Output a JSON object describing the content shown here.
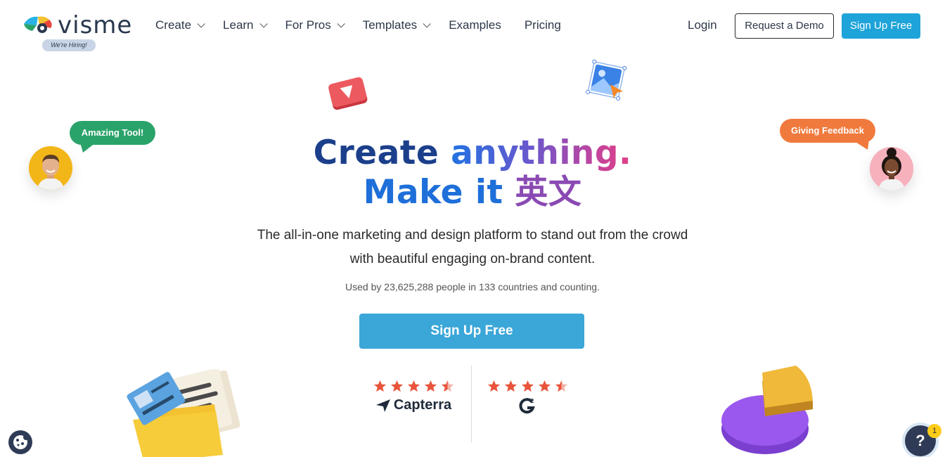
{
  "nav": {
    "logo_text": "visme",
    "hiring_badge": "We're Hiring!",
    "menu": [
      {
        "label": "Create",
        "has_dropdown": true
      },
      {
        "label": "Learn",
        "has_dropdown": true
      },
      {
        "label": "For Pros",
        "has_dropdown": true
      },
      {
        "label": "Templates",
        "has_dropdown": true
      },
      {
        "label": "Examples",
        "has_dropdown": false
      },
      {
        "label": "Pricing",
        "has_dropdown": false
      }
    ],
    "login": "Login",
    "request_demo": "Request a Demo",
    "sign_up": "Sign Up Free"
  },
  "hero": {
    "title_line1_part1": "Create",
    "title_line1_part2": "anything.",
    "title_line2_part1": "Make it",
    "title_line2_part2": "英文",
    "subtitle_line1": "The all-in-one marketing and design platform to stand out from the crowd",
    "subtitle_line2": "with beautiful engaging on-brand content.",
    "used_by": "Used by 23,625,288 people in 133 countries and counting.",
    "cta": "Sign Up Free"
  },
  "ratings": [
    {
      "platform": "Capterra",
      "stars": 4.5
    },
    {
      "platform": "G2",
      "stars": 4.5
    }
  ],
  "floating": {
    "bubble_left": "Amazing Tool!",
    "bubble_right": "Giving Feedback"
  },
  "widgets": {
    "help_label": "?",
    "help_badge": "1"
  },
  "colors": {
    "brand_blue": "#1fa4d9",
    "cta_blue": "#3ba6d8",
    "title_navy": "#1b3f8b",
    "star_red": "#e8543b",
    "green_bubble": "#2aa36b",
    "orange_bubble": "#f07a3d"
  },
  "icons": [
    "visme-logo-icon",
    "chevron-down-icon",
    "play-icon",
    "image-icon",
    "star-icon",
    "capterra-icon",
    "g2-icon",
    "folder-illustration",
    "pie-chart-illustration",
    "cookie-icon",
    "help-icon"
  ]
}
